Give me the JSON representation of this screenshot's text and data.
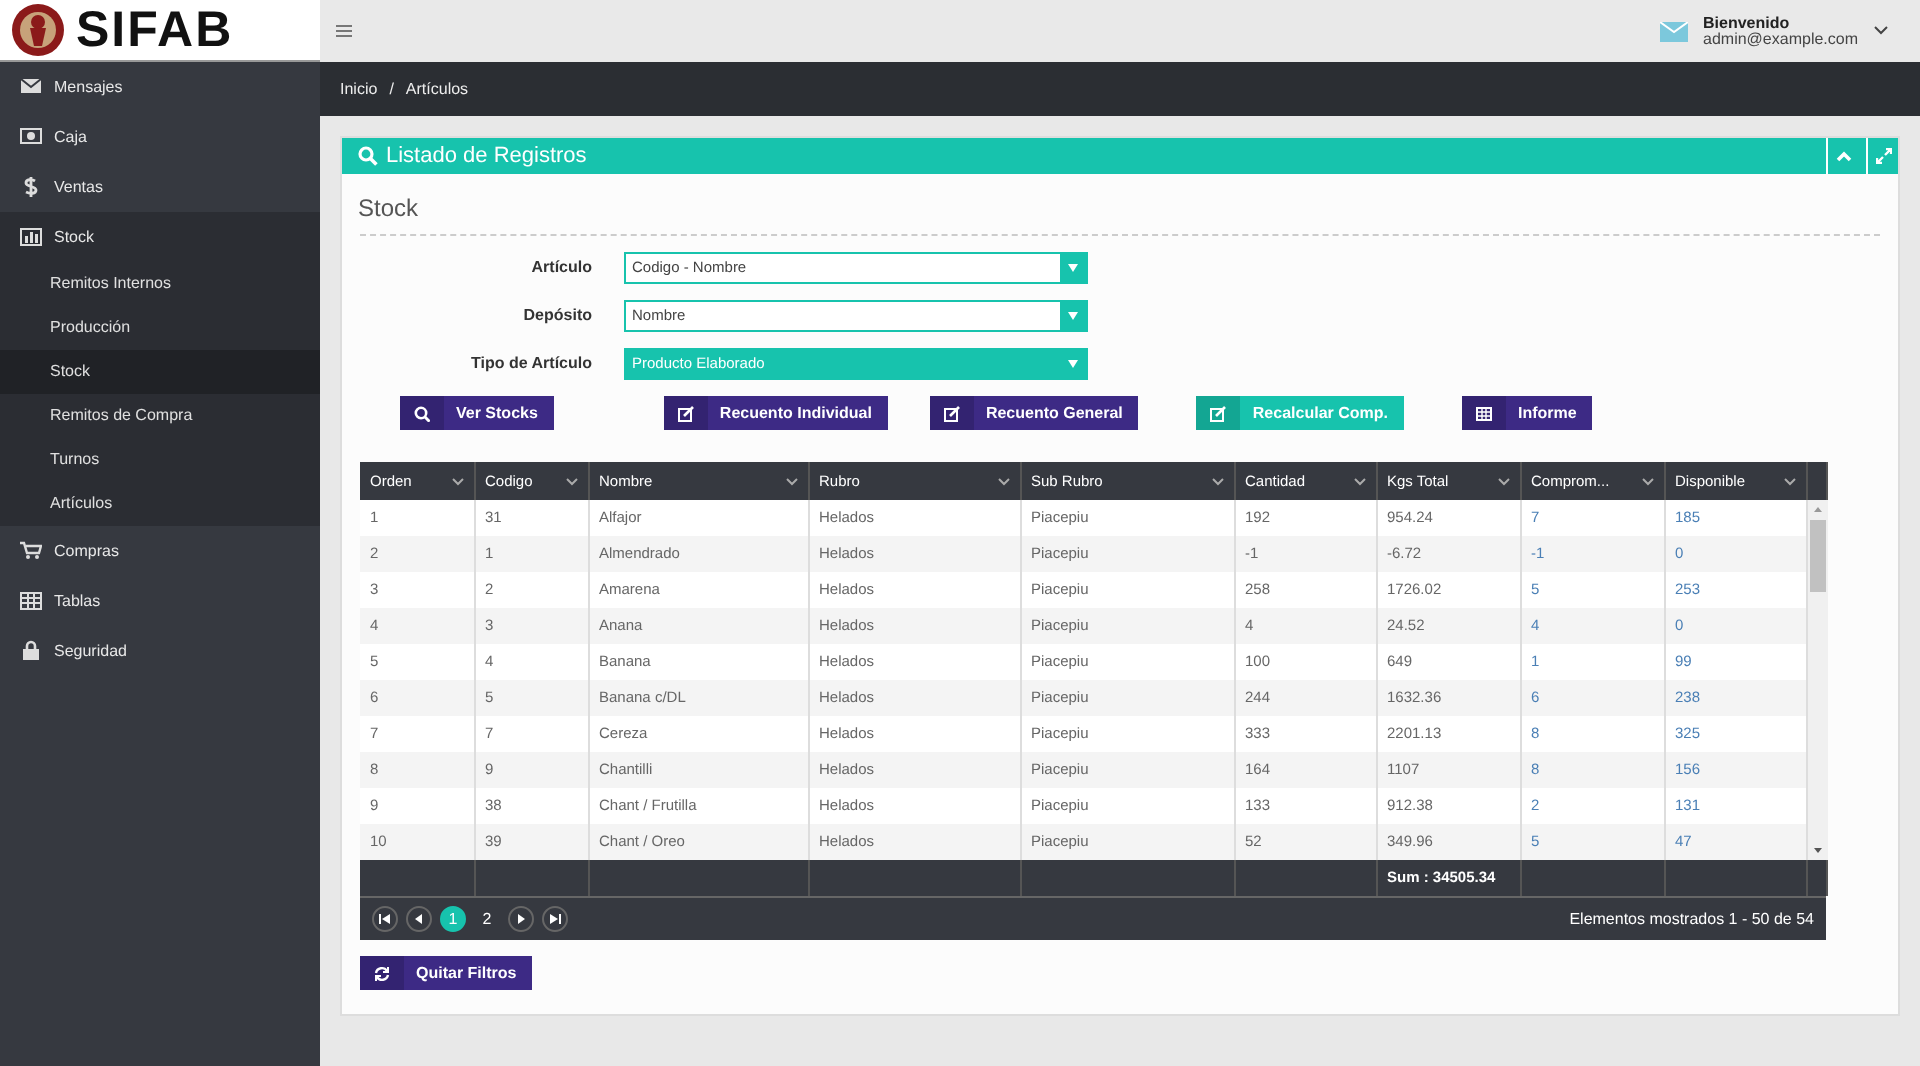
{
  "logo": "SIFAB",
  "user": {
    "greeting": "Bienvenido",
    "email": "admin@example.com"
  },
  "breadcrumb": {
    "items": [
      "Inicio",
      "Artículos"
    ],
    "separator": "/"
  },
  "sidebar": {
    "items": [
      {
        "label": "Mensajes",
        "expanded": false
      },
      {
        "label": "Caja",
        "expanded": false
      },
      {
        "label": "Ventas",
        "expanded": false
      },
      {
        "label": "Stock",
        "expanded": true,
        "children": [
          {
            "label": "Remitos Internos",
            "selected": false
          },
          {
            "label": "Producción",
            "selected": false
          },
          {
            "label": "Stock",
            "selected": true
          },
          {
            "label": "Remitos de Compra",
            "selected": false
          },
          {
            "label": "Turnos",
            "selected": false
          },
          {
            "label": "Artículos",
            "selected": false
          }
        ]
      },
      {
        "label": "Compras",
        "expanded": false
      },
      {
        "label": "Tablas",
        "expanded": false
      },
      {
        "label": "Seguridad",
        "expanded": false
      }
    ]
  },
  "panel": {
    "title": "Listado de Registros",
    "heading": "Stock"
  },
  "filters": [
    {
      "label": "Artículo",
      "value": "Codigo - Nombre",
      "highlighted": false
    },
    {
      "label": "Depósito",
      "value": "Nombre",
      "highlighted": false
    },
    {
      "label": "Tipo de Artículo",
      "value": "Producto Elaborado",
      "highlighted": true
    }
  ],
  "buttons": [
    {
      "label": "Ver Stocks",
      "kind": "search",
      "color": "#3d2a85"
    },
    {
      "label": "Recuento Individual",
      "kind": "edit",
      "color": "#3d2a85"
    },
    {
      "label": "Recuento General",
      "kind": "edit",
      "color": "#3d2a85"
    },
    {
      "label": "Recalcular Comp.",
      "kind": "edit",
      "color": "#17c3ad"
    },
    {
      "label": "Informe",
      "kind": "table",
      "color": "#3d2a85"
    }
  ],
  "table": {
    "columns": [
      {
        "label": "Orden"
      },
      {
        "label": "Codigo"
      },
      {
        "label": "Nombre"
      },
      {
        "label": "Rubro"
      },
      {
        "label": "Sub Rubro"
      },
      {
        "label": "Cantidad"
      },
      {
        "label": "Kgs Total",
        "footer": "Sum : 34505.34"
      },
      {
        "label": "Comprom..."
      },
      {
        "label": "Disponible"
      }
    ],
    "rows": [
      [
        "1",
        "31",
        "Alfajor",
        "Helados",
        "Piacepiu",
        "192",
        "954.24",
        "7",
        "185"
      ],
      [
        "2",
        "1",
        "Almendrado",
        "Helados",
        "Piacepiu",
        "-1",
        "-6.72",
        "-1",
        "0"
      ],
      [
        "3",
        "2",
        "Amarena",
        "Helados",
        "Piacepiu",
        "258",
        "1726.02",
        "5",
        "253"
      ],
      [
        "4",
        "3",
        "Anana",
        "Helados",
        "Piacepiu",
        "4",
        "24.52",
        "4",
        "0"
      ],
      [
        "5",
        "4",
        "Banana",
        "Helados",
        "Piacepiu",
        "100",
        "649",
        "1",
        "99"
      ],
      [
        "6",
        "5",
        "Banana c/DL",
        "Helados",
        "Piacepiu",
        "244",
        "1632.36",
        "6",
        "238"
      ],
      [
        "7",
        "7",
        "Cereza",
        "Helados",
        "Piacepiu",
        "333",
        "2201.13",
        "8",
        "325"
      ],
      [
        "8",
        "9",
        "Chantilli",
        "Helados",
        "Piacepiu",
        "164",
        "1107",
        "8",
        "156"
      ],
      [
        "9",
        "38",
        "Chant / Frutilla",
        "Helados",
        "Piacepiu",
        "133",
        "912.38",
        "2",
        "131"
      ],
      [
        "10",
        "39",
        "Chant / Oreo",
        "Helados",
        "Piacepiu",
        "52",
        "349.96",
        "5",
        "47"
      ]
    ]
  },
  "pager": {
    "pages": [
      {
        "label": "1",
        "selected": true
      },
      {
        "label": "2",
        "selected": false
      }
    ],
    "info": "Elementos mostrados 1 - 50 de 54"
  },
  "clear_button": {
    "label": "Quitar Filtros"
  }
}
